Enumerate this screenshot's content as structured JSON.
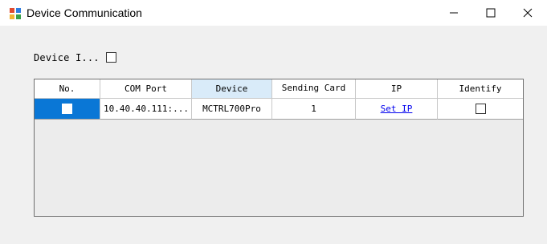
{
  "window": {
    "title": "Device Communication",
    "controls": {
      "minimize": "—",
      "maximize": "☐",
      "close": "✕"
    }
  },
  "filter": {
    "label": "Device I...",
    "checked": false
  },
  "table": {
    "columns": [
      "No.",
      "COM Port",
      "Device",
      "Sending Card",
      "IP",
      "Identify"
    ],
    "rows": [
      {
        "no_checked": false,
        "com_port": "10.40.40.111:...",
        "device": "MCTRL700Pro",
        "sending_card": "1",
        "ip_link": "Set IP",
        "identify_checked": false
      }
    ]
  },
  "colors": {
    "selection": "#0a77d6",
    "header_active": "#d9ebf9",
    "link": "#0000ee"
  }
}
